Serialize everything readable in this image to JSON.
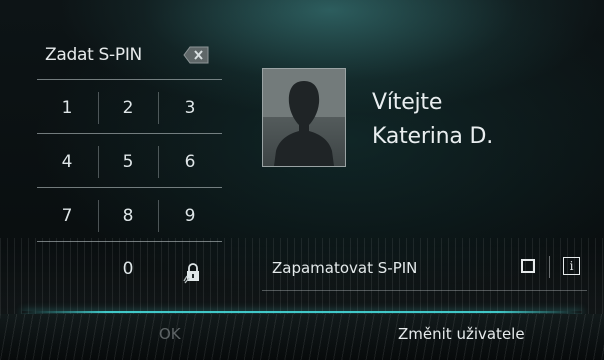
{
  "pin_pad": {
    "title": "Zadat S-PIN",
    "backspace_icon": "backspace-icon",
    "keys": [
      "1",
      "2",
      "3",
      "4",
      "5",
      "6",
      "7",
      "8",
      "9",
      "0"
    ],
    "bottom_right_icon": "hand-lock-icon"
  },
  "profile": {
    "avatar_icon": "user-silhouette-icon",
    "welcome": "Vítejte",
    "username": "Katerina D."
  },
  "remember": {
    "label": "Zapamatovat S-PIN",
    "checkbox_icon": "checkbox-icon",
    "info_icon": "info-icon",
    "info_glyph": "i"
  },
  "footer": {
    "ok_label": "OK",
    "change_user_label": "Změnit uživatele"
  },
  "colors": {
    "accent_teal": "#46dcdc",
    "text": "#e6eaeb",
    "disabled_text": "#5e6466",
    "background": "#0a0f10"
  }
}
